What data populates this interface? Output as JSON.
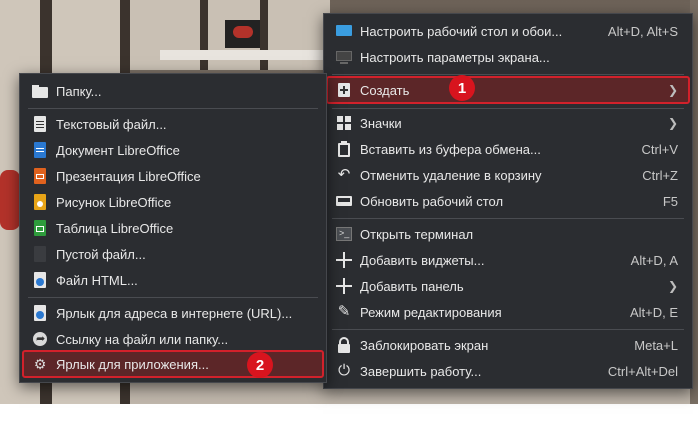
{
  "context_menu": {
    "items": [
      {
        "label": "Настроить рабочий стол и обои...",
        "shortcut": "Alt+D, Alt+S",
        "icon": "desktop-wallpaper-icon"
      },
      {
        "label": "Настроить параметры экрана...",
        "shortcut": "",
        "icon": "display-icon"
      },
      {
        "label": "Создать",
        "shortcut": "",
        "icon": "plus-box-icon",
        "submenu": true
      },
      {
        "label": "Значки",
        "shortcut": "",
        "icon": "grid-icon",
        "submenu": true
      },
      {
        "label": "Вставить из буфера обмена...",
        "shortcut": "Ctrl+V",
        "icon": "clipboard-icon"
      },
      {
        "label": "Отменить удаление в корзину",
        "shortcut": "Ctrl+Z",
        "icon": "undo-icon"
      },
      {
        "label": "Обновить рабочий стол",
        "shortcut": "F5",
        "icon": "refresh-desktop-icon"
      },
      {
        "label": "Открыть терминал",
        "shortcut": "",
        "icon": "terminal-icon"
      },
      {
        "label": "Добавить виджеты...",
        "shortcut": "Alt+D, A",
        "icon": "plus-icon"
      },
      {
        "label": "Добавить панель",
        "shortcut": "",
        "icon": "plus-icon",
        "submenu": true
      },
      {
        "label": "Режим редактирования",
        "shortcut": "Alt+D, E",
        "icon": "pencil-icon"
      },
      {
        "label": "Заблокировать экран",
        "shortcut": "Meta+L",
        "icon": "lock-icon"
      },
      {
        "label": "Завершить работу...",
        "shortcut": "Ctrl+Alt+Del",
        "icon": "power-icon"
      }
    ]
  },
  "create_submenu": {
    "items": [
      {
        "label": "Папку...",
        "icon": "folder-icon"
      },
      {
        "label": "Текстовый файл...",
        "icon": "text-file-icon"
      },
      {
        "label": "Документ LibreOffice",
        "icon": "writer-icon"
      },
      {
        "label": "Презентация LibreOffice",
        "icon": "impress-icon"
      },
      {
        "label": "Рисунок LibreOffice",
        "icon": "draw-icon"
      },
      {
        "label": "Таблица LibreOffice",
        "icon": "calc-icon"
      },
      {
        "label": "Пустой файл...",
        "icon": "empty-file-icon"
      },
      {
        "label": "Файл HTML...",
        "icon": "html-file-icon"
      },
      {
        "label": "Ярлык для адреса в интернете (URL)...",
        "icon": "url-link-icon"
      },
      {
        "label": "Ссылку на файл или папку...",
        "icon": "file-link-icon"
      },
      {
        "label": "Ярлык для приложения...",
        "icon": "app-link-icon"
      }
    ]
  },
  "badges": {
    "first": "1",
    "second": "2"
  },
  "colors": {
    "menu_bg": "#2b2d31",
    "highlight_border": "#d2212b",
    "badge": "#d8141e"
  }
}
